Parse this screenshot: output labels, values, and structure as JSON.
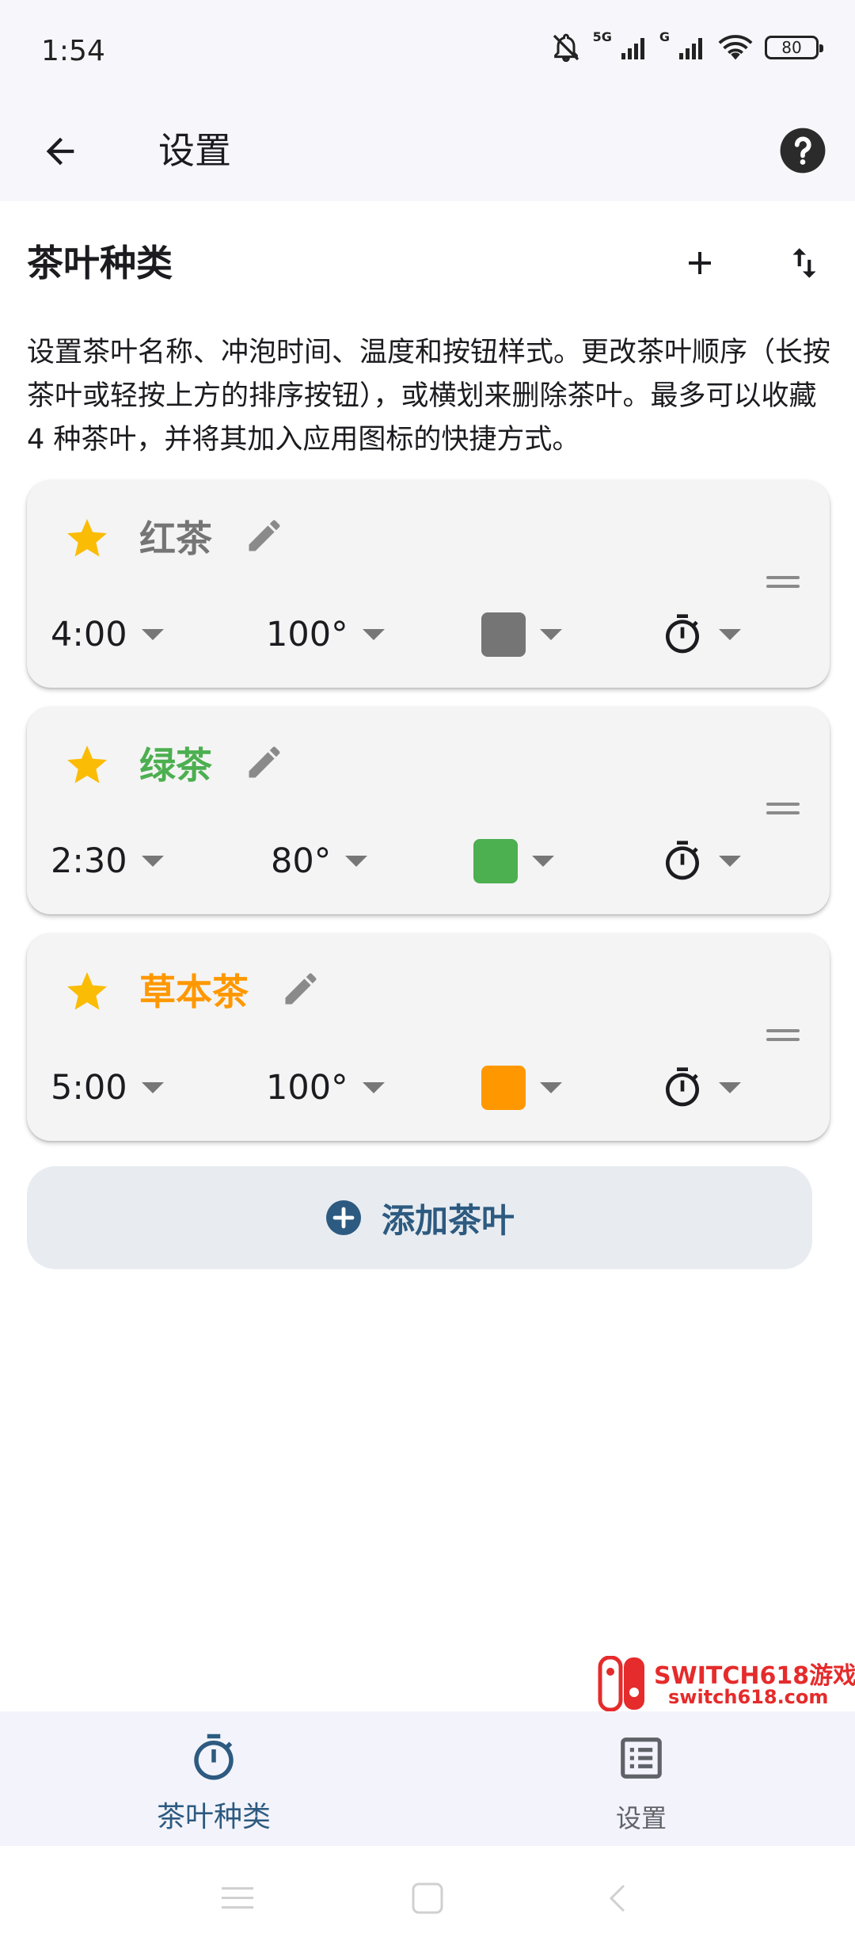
{
  "status_bar": {
    "time": "1:54",
    "network_1": "5G",
    "network_2": "G",
    "battery": "80"
  },
  "app_bar": {
    "title": "设置"
  },
  "section": {
    "title": "茶叶种类",
    "description": "设置茶叶名称、冲泡时间、温度和按钮样式。更改茶叶顺序（长按茶叶或轻按上方的排序按钮），或横划来删除茶叶。最多可以收藏 4 种茶叶，并将其加入应用图标的快捷方式。"
  },
  "teas": [
    {
      "name": "红茶",
      "time": "4:00",
      "temperature": "100°",
      "color": "#757575",
      "name_color": "#757575",
      "favorite": true
    },
    {
      "name": "绿茶",
      "time": "2:30",
      "temperature": "80°",
      "color": "#4caf50",
      "name_color": "#4caf50",
      "favorite": true
    },
    {
      "name": "草本茶",
      "time": "5:00",
      "temperature": "100°",
      "color": "#ff9800",
      "name_color": "#ff9800",
      "favorite": true
    }
  ],
  "add_tea": {
    "label": "添加茶叶"
  },
  "watermark": {
    "line1": "SWITCH618游戏",
    "line2": "switch618.com"
  },
  "bottom_nav": {
    "items": [
      {
        "label": "茶叶种类",
        "icon": "timer-icon",
        "active": true
      },
      {
        "label": "设置",
        "icon": "list-icon",
        "active": false
      }
    ]
  },
  "colors": {
    "accent": "#2d5a80",
    "star": "#fbbc05",
    "muted": "#777777"
  }
}
